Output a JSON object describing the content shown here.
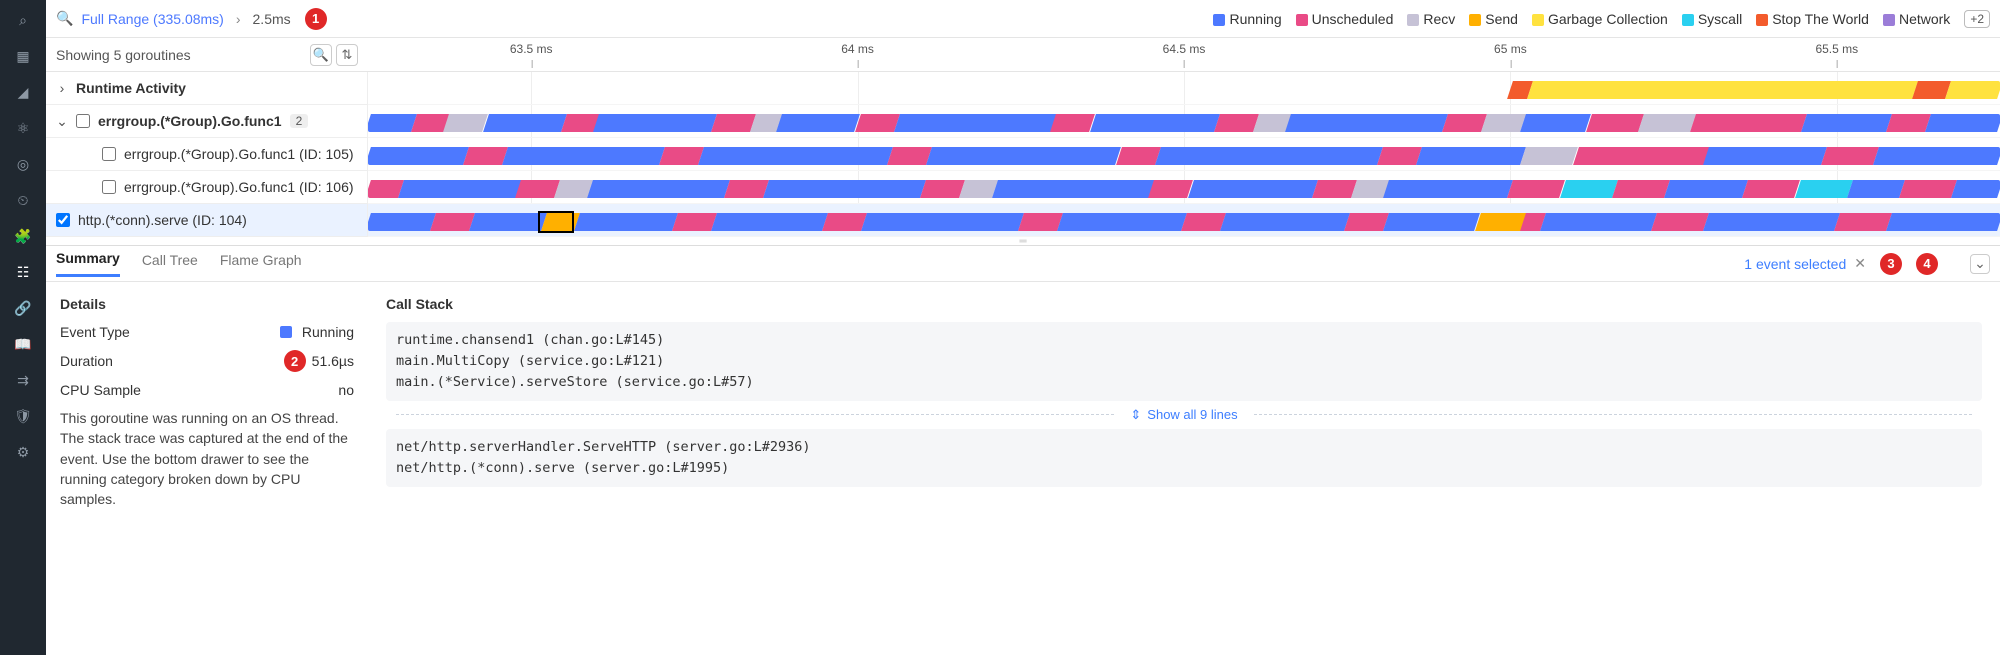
{
  "breadcrumb": {
    "range_label": "Full Range (335.08ms)",
    "current": "2.5ms"
  },
  "legend": {
    "items": [
      {
        "label": "Running",
        "color": "#4d79ff"
      },
      {
        "label": "Unscheduled",
        "color": "#e94b86"
      },
      {
        "label": "Recv",
        "color": "#c6c2d6"
      },
      {
        "label": "Send",
        "color": "#ffb000"
      },
      {
        "label": "Garbage Collection",
        "color": "#ffe23f"
      },
      {
        "label": "Syscall",
        "color": "#2ad0f0"
      },
      {
        "label": "Stop The World",
        "color": "#f35b2c"
      },
      {
        "label": "Network",
        "color": "#9b7dd8"
      }
    ],
    "overflow": "+2"
  },
  "goroutines": {
    "count_text": "Showing 5 goroutines"
  },
  "ticks": [
    "63.5 ms",
    "64 ms",
    "64.5 ms",
    "65 ms",
    "65.5 ms"
  ],
  "tree": {
    "runtime_activity": "Runtime Activity",
    "group": "errgroup.(*Group).Go.func1",
    "group_count": "2",
    "children": [
      "errgroup.(*Group).Go.func1 (ID: 105)",
      "errgroup.(*Group).Go.func1 (ID: 106)"
    ],
    "selected": "http.(*conn).serve (ID: 104)"
  },
  "tabs": {
    "summary": "Summary",
    "call_tree": "Call Tree",
    "flame_graph": "Flame Graph",
    "selection": "1 event selected"
  },
  "details": {
    "heading": "Details",
    "event_type_label": "Event Type",
    "event_type_value": "Running",
    "duration_label": "Duration",
    "duration_value": "51.6µs",
    "cpu_sample_label": "CPU Sample",
    "cpu_sample_value": "no",
    "description": "This goroutine was running on an OS thread. The stack trace was captured at the end of the event. Use the bottom drawer to see the running category broken down by CPU samples."
  },
  "stack": {
    "heading": "Call Stack",
    "top": [
      "runtime.chansend1 (chan.go:L#145)",
      "main.MultiCopy (service.go:L#121)",
      "main.(*Service).serveStore (service.go:L#57)"
    ],
    "show_all": "Show all 9 lines",
    "bottom": [
      "net/http.serverHandler.ServeHTTP (server.go:L#2936)",
      "net/http.(*conn).serve (server.go:L#1995)"
    ]
  },
  "markers": {
    "m1": "1",
    "m2": "2",
    "m3": "3",
    "m4": "4"
  },
  "chart_data": {
    "type": "timeline",
    "x_unit": "ms",
    "x_range": [
      63.25,
      65.75
    ],
    "ticks_ms": [
      63.5,
      64.0,
      64.5,
      65.0,
      65.5
    ],
    "categories": {
      "Running": "#4d79ff",
      "Unscheduled": "#e94b86",
      "Recv": "#c6c2d6",
      "Send": "#ffb000",
      "Garbage Collection": "#ffe23f",
      "Syscall": "#2ad0f0",
      "Stop The World": "#f35b2c",
      "Network": "#9b7dd8"
    },
    "lanes": [
      {
        "name": "Runtime Activity",
        "segments": [
          {
            "start": 65.0,
            "end": 65.03,
            "cat": "Stop The World"
          },
          {
            "start": 65.03,
            "end": 65.62,
            "cat": "Garbage Collection"
          },
          {
            "start": 65.62,
            "end": 65.67,
            "cat": "Stop The World"
          },
          {
            "start": 65.67,
            "end": 65.75,
            "cat": "Garbage Collection"
          }
        ]
      },
      {
        "name": "errgroup.(*Group).Go.func1 (aggregate)",
        "segments": [
          {
            "start": 63.25,
            "end": 63.32,
            "cat": "Running"
          },
          {
            "start": 63.32,
            "end": 63.37,
            "cat": "Unscheduled"
          },
          {
            "start": 63.37,
            "end": 63.43,
            "cat": "Recv"
          },
          {
            "start": 63.43,
            "end": 63.55,
            "cat": "Running"
          },
          {
            "start": 63.55,
            "end": 63.6,
            "cat": "Unscheduled"
          },
          {
            "start": 63.6,
            "end": 63.78,
            "cat": "Running"
          },
          {
            "start": 63.78,
            "end": 63.84,
            "cat": "Unscheduled"
          },
          {
            "start": 63.84,
            "end": 63.88,
            "cat": "Recv"
          },
          {
            "start": 63.88,
            "end": 64.0,
            "cat": "Running"
          },
          {
            "start": 64.0,
            "end": 64.06,
            "cat": "Unscheduled"
          },
          {
            "start": 64.06,
            "end": 64.3,
            "cat": "Running"
          },
          {
            "start": 64.3,
            "end": 64.36,
            "cat": "Unscheduled"
          },
          {
            "start": 64.36,
            "end": 64.55,
            "cat": "Running"
          },
          {
            "start": 64.55,
            "end": 64.61,
            "cat": "Unscheduled"
          },
          {
            "start": 64.61,
            "end": 64.66,
            "cat": "Recv"
          },
          {
            "start": 64.66,
            "end": 64.9,
            "cat": "Running"
          },
          {
            "start": 64.9,
            "end": 64.96,
            "cat": "Unscheduled"
          },
          {
            "start": 64.96,
            "end": 65.02,
            "cat": "Recv"
          },
          {
            "start": 65.02,
            "end": 65.12,
            "cat": "Running"
          },
          {
            "start": 65.12,
            "end": 65.2,
            "cat": "Unscheduled"
          },
          {
            "start": 65.2,
            "end": 65.28,
            "cat": "Recv"
          },
          {
            "start": 65.28,
            "end": 65.45,
            "cat": "Unscheduled"
          },
          {
            "start": 65.45,
            "end": 65.58,
            "cat": "Running"
          },
          {
            "start": 65.58,
            "end": 65.64,
            "cat": "Unscheduled"
          },
          {
            "start": 65.64,
            "end": 65.75,
            "cat": "Running"
          }
        ]
      },
      {
        "name": "errgroup.(*Group).Go.func1 (ID: 105)",
        "segments": [
          {
            "start": 63.25,
            "end": 63.4,
            "cat": "Running"
          },
          {
            "start": 63.4,
            "end": 63.46,
            "cat": "Unscheduled"
          },
          {
            "start": 63.46,
            "end": 63.7,
            "cat": "Running"
          },
          {
            "start": 63.7,
            "end": 63.76,
            "cat": "Unscheduled"
          },
          {
            "start": 63.76,
            "end": 64.05,
            "cat": "Running"
          },
          {
            "start": 64.05,
            "end": 64.11,
            "cat": "Unscheduled"
          },
          {
            "start": 64.11,
            "end": 64.4,
            "cat": "Running"
          },
          {
            "start": 64.4,
            "end": 64.46,
            "cat": "Unscheduled"
          },
          {
            "start": 64.46,
            "end": 64.8,
            "cat": "Running"
          },
          {
            "start": 64.8,
            "end": 64.86,
            "cat": "Unscheduled"
          },
          {
            "start": 64.86,
            "end": 65.02,
            "cat": "Running"
          },
          {
            "start": 65.02,
            "end": 65.1,
            "cat": "Recv"
          },
          {
            "start": 65.1,
            "end": 65.3,
            "cat": "Unscheduled"
          },
          {
            "start": 65.3,
            "end": 65.48,
            "cat": "Running"
          },
          {
            "start": 65.48,
            "end": 65.56,
            "cat": "Unscheduled"
          },
          {
            "start": 65.56,
            "end": 65.75,
            "cat": "Running"
          }
        ]
      },
      {
        "name": "errgroup.(*Group).Go.func1 (ID: 106)",
        "segments": [
          {
            "start": 63.25,
            "end": 63.3,
            "cat": "Unscheduled"
          },
          {
            "start": 63.3,
            "end": 63.48,
            "cat": "Running"
          },
          {
            "start": 63.48,
            "end": 63.54,
            "cat": "Unscheduled"
          },
          {
            "start": 63.54,
            "end": 63.59,
            "cat": "Recv"
          },
          {
            "start": 63.59,
            "end": 63.8,
            "cat": "Running"
          },
          {
            "start": 63.8,
            "end": 63.86,
            "cat": "Unscheduled"
          },
          {
            "start": 63.86,
            "end": 64.1,
            "cat": "Running"
          },
          {
            "start": 64.1,
            "end": 64.16,
            "cat": "Unscheduled"
          },
          {
            "start": 64.16,
            "end": 64.21,
            "cat": "Recv"
          },
          {
            "start": 64.21,
            "end": 64.45,
            "cat": "Running"
          },
          {
            "start": 64.45,
            "end": 64.51,
            "cat": "Unscheduled"
          },
          {
            "start": 64.51,
            "end": 64.7,
            "cat": "Running"
          },
          {
            "start": 64.7,
            "end": 64.76,
            "cat": "Unscheduled"
          },
          {
            "start": 64.76,
            "end": 64.81,
            "cat": "Recv"
          },
          {
            "start": 64.81,
            "end": 65.0,
            "cat": "Running"
          },
          {
            "start": 65.0,
            "end": 65.08,
            "cat": "Unscheduled"
          },
          {
            "start": 65.08,
            "end": 65.16,
            "cat": "Syscall"
          },
          {
            "start": 65.16,
            "end": 65.24,
            "cat": "Unscheduled"
          },
          {
            "start": 65.24,
            "end": 65.36,
            "cat": "Running"
          },
          {
            "start": 65.36,
            "end": 65.44,
            "cat": "Unscheduled"
          },
          {
            "start": 65.44,
            "end": 65.52,
            "cat": "Syscall"
          },
          {
            "start": 65.52,
            "end": 65.6,
            "cat": "Running"
          },
          {
            "start": 65.6,
            "end": 65.68,
            "cat": "Unscheduled"
          },
          {
            "start": 65.68,
            "end": 65.75,
            "cat": "Running"
          }
        ]
      },
      {
        "name": "http.(*conn).serve (ID: 104)",
        "segments": [
          {
            "start": 63.25,
            "end": 63.35,
            "cat": "Running"
          },
          {
            "start": 63.35,
            "end": 63.41,
            "cat": "Unscheduled"
          },
          {
            "start": 63.41,
            "end": 63.52,
            "cat": "Running"
          },
          {
            "start": 63.52,
            "end": 63.57,
            "cat": "Send"
          },
          {
            "start": 63.57,
            "end": 63.72,
            "cat": "Running"
          },
          {
            "start": 63.72,
            "end": 63.78,
            "cat": "Unscheduled"
          },
          {
            "start": 63.78,
            "end": 63.95,
            "cat": "Running"
          },
          {
            "start": 63.95,
            "end": 64.01,
            "cat": "Unscheduled"
          },
          {
            "start": 64.01,
            "end": 64.25,
            "cat": "Running"
          },
          {
            "start": 64.25,
            "end": 64.31,
            "cat": "Unscheduled"
          },
          {
            "start": 64.31,
            "end": 64.5,
            "cat": "Running"
          },
          {
            "start": 64.5,
            "end": 64.56,
            "cat": "Unscheduled"
          },
          {
            "start": 64.56,
            "end": 64.75,
            "cat": "Running"
          },
          {
            "start": 64.75,
            "end": 64.81,
            "cat": "Unscheduled"
          },
          {
            "start": 64.81,
            "end": 64.95,
            "cat": "Running"
          },
          {
            "start": 64.95,
            "end": 65.02,
            "cat": "Send"
          },
          {
            "start": 65.02,
            "end": 65.05,
            "cat": "Unscheduled"
          },
          {
            "start": 65.05,
            "end": 65.22,
            "cat": "Running"
          },
          {
            "start": 65.22,
            "end": 65.3,
            "cat": "Unscheduled"
          },
          {
            "start": 65.3,
            "end": 65.5,
            "cat": "Running"
          },
          {
            "start": 65.5,
            "end": 65.58,
            "cat": "Unscheduled"
          },
          {
            "start": 65.58,
            "end": 65.75,
            "cat": "Running"
          }
        ],
        "selected_event": {
          "start": 63.51,
          "end": 63.565
        }
      }
    ]
  }
}
